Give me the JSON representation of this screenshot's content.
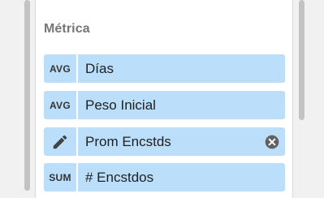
{
  "section": {
    "title": "Métrica"
  },
  "metrics": [
    {
      "type": "AVG",
      "label": "Días"
    },
    {
      "type": "AVG",
      "label": "Peso Inicial"
    },
    {
      "type": "pencil-icon",
      "label": "Prom Encstds"
    },
    {
      "type": "SUM",
      "label": "# Encstdos"
    }
  ],
  "colors": {
    "chip_background": "#bbdefb",
    "icon": "#424242",
    "close_icon": "#616161"
  }
}
